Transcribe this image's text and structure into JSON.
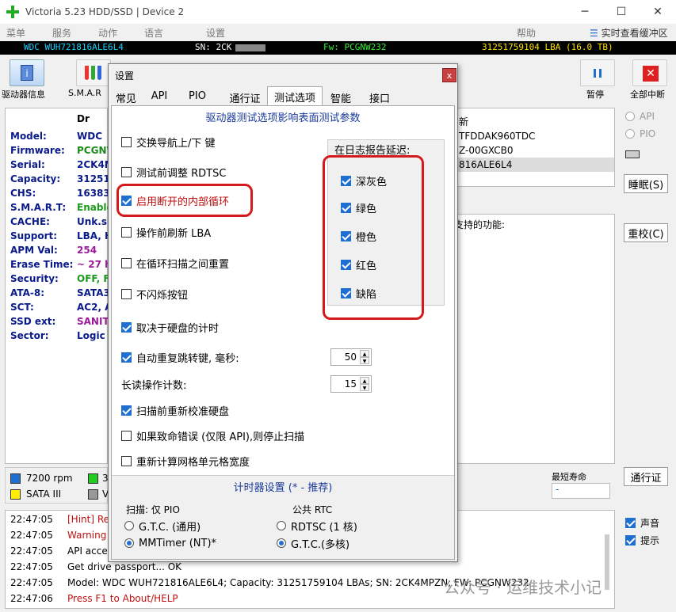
{
  "window": {
    "title": "Victoria 5.23 HDD/SSD | Device 2",
    "controls": {
      "minimize": "─",
      "maximize": "☐",
      "close": "✕"
    }
  },
  "menu": {
    "items": [
      "菜单",
      "服务",
      "动作",
      "语言",
      "设置"
    ],
    "help": "帮助",
    "realtime_label": "实时查看缓冲区"
  },
  "device_bar": {
    "model": "WDC  WUH721816ALE6L4",
    "sn": "SN: 2CK",
    "fw": "Fw: PCGNW232",
    "lba": "31251759104 LBA (16.0 TB)",
    "colors": {
      "model": "#19d0ff",
      "sn": "#ffffff",
      "fw": "#33ee33",
      "lba": "#ffe000"
    }
  },
  "toolbar": {
    "drive_info": "驱动器信息",
    "smart": "S.M.A.R",
    "pause": "暂停",
    "stop_all": "全部中断"
  },
  "info_panel": {
    "header": "Dr",
    "rows": [
      {
        "key": "Model:",
        "val": "WDC",
        "color": "#0a1a8a"
      },
      {
        "key": "Firmware:",
        "val": "PCGNV",
        "color": "#1a8a1a"
      },
      {
        "key": "Serial:",
        "val": "2CK4M",
        "color": "#0a1a8a"
      },
      {
        "key": "Capacity:",
        "val": "31251",
        "color": "#0a1a8a"
      },
      {
        "key": "CHS:",
        "val": "16383",
        "color": "#0a1a8a"
      },
      {
        "key": "S.M.A.R.T:",
        "val": "Enable",
        "color": "#1a9a1a"
      },
      {
        "key": "CACHE:",
        "val": "Unk.siz",
        "color": "#0a1a8a"
      },
      {
        "key": "Support:",
        "val": "LBA, H",
        "color": "#0a1a8a"
      },
      {
        "key": "APM Val:",
        "val": "254",
        "color": "#9a1a9a"
      },
      {
        "key": "Erase Time:",
        "val": "~ 27 h",
        "color": "#9a1a9a"
      },
      {
        "key": "Security:",
        "val": "OFF, Fr",
        "color": "#1a9a1a"
      },
      {
        "key": "ATA-8:",
        "val": "SATA3",
        "color": "#0a1a8a"
      },
      {
        "key": "SCT:",
        "val": "AC2, A",
        "color": "#0a1a8a"
      },
      {
        "key": "SSD ext:",
        "val": "SANIT",
        "color": "#9a1a9a"
      },
      {
        "key": "Sector:",
        "val": "Logic S",
        "color": "#0a1a8a"
      }
    ]
  },
  "right_panel": {
    "header": "新",
    "lines": [
      "TFDDAK960TDC",
      "Z-00GXCB0",
      "816ALE6L4"
    ],
    "features_label": "支持的功能:"
  },
  "side_panel": {
    "api": "API",
    "pio": "PIO",
    "sleep": "睡眠(S)",
    "recalibrate": "重校(C)",
    "passport": "通行证"
  },
  "legend": {
    "items": [
      {
        "label": "7200 rpm",
        "color": "#1e6fd0"
      },
      {
        "label": "3",
        "color": "#22cc22"
      },
      {
        "label": "SATA III",
        "color": "#ffee00"
      },
      {
        "label": "V",
        "color": "#999999"
      }
    ]
  },
  "min_life": {
    "label": "最短寿命",
    "value": "-"
  },
  "log": {
    "rows": [
      {
        "time": "22:47:05",
        "msg": "[Hint] Rec",
        "color": "#c01010"
      },
      {
        "time": "22:47:05",
        "msg": "Warning!",
        "color": "#c01010"
      },
      {
        "time": "22:47:05",
        "msg": "API acces",
        "color": "#000000"
      },
      {
        "time": "22:47:05",
        "msg": "Get drive passport... OK",
        "color": "#000000"
      },
      {
        "time": "22:47:05",
        "msg": "Model: WDC  WUH721816ALE6L4; Capacity: 31251759104 LBAs; SN: 2CK4MPZN; FW: PCGNW232",
        "color": "#000000"
      },
      {
        "time": "22:47:06",
        "msg": "Press F1 to About/HELP",
        "color": "#c01010"
      }
    ],
    "sound": "声音",
    "hints": "提示"
  },
  "dialog": {
    "title": "设置",
    "close": "x",
    "tabs": [
      "常见",
      "API",
      "PIO",
      "通行证",
      "测试选项",
      "智能",
      "接口"
    ],
    "active_tab": 4,
    "section_title": "驱动器测试选项影响表面测试参数",
    "options": [
      {
        "label": "交换导航上/下 键",
        "checked": false
      },
      {
        "label": "测试前调整 RDTSC",
        "checked": false
      },
      {
        "label": "启用断开的内部循环",
        "checked": true,
        "red": true
      },
      {
        "label": "操作前刷新 LBA",
        "checked": false
      },
      {
        "label": "在循环扫描之间重置",
        "checked": false
      },
      {
        "label": "不闪烁按钮",
        "checked": false
      },
      {
        "label": "取决于硬盘的计时",
        "checked": true
      },
      {
        "label": "自动重复跳转键, 毫秒:",
        "checked": true
      }
    ],
    "long_read_label": "长读操作计数:",
    "spin_values": {
      "auto_repeat": "50",
      "long_read": "15"
    },
    "options2": [
      {
        "label": "扫描前重新校准硬盘",
        "checked": true
      },
      {
        "label": "如果致命错误 (仅限 API),则停止扫描",
        "checked": false
      },
      {
        "label": "重新计算网格单元格宽度",
        "checked": false
      }
    ],
    "log_delay": {
      "title": "在日志报告延迟:",
      "items": [
        {
          "label": "深灰色",
          "checked": true
        },
        {
          "label": "绿色",
          "checked": true
        },
        {
          "label": "橙色",
          "checked": true
        },
        {
          "label": "红色",
          "checked": true
        },
        {
          "label": "缺陷",
          "checked": true
        }
      ]
    },
    "timer": {
      "title": "计时器设置  (* - 推荐)",
      "scan_label": "扫描: 仅 PIO",
      "common_label": "公共 RTC",
      "gtc_general": "G.T.C. (通用)",
      "mmtimer": "MMTimer (NT)*",
      "rdtsc": "RDTSC (1 核)",
      "gtc_multi": "G.T.C.(多核)"
    }
  },
  "watermark": "公众号 · 运维技术小记"
}
